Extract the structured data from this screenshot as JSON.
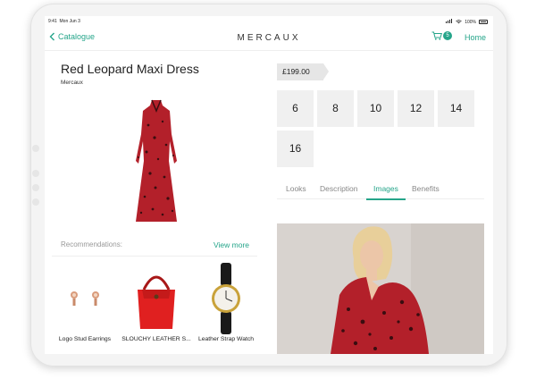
{
  "status": {
    "time": "9:41",
    "date": "Mon Jun 3",
    "battery": "100%"
  },
  "nav": {
    "back_label": "Catalogue",
    "brand": "MERCAUX",
    "cart_count": "5",
    "home_label": "Home"
  },
  "product": {
    "title": "Red Leopard Maxi Dress",
    "brand": "Mercaux",
    "price": "£199.00"
  },
  "sizes": [
    "6",
    "8",
    "10",
    "12",
    "14",
    "16"
  ],
  "tabs": [
    {
      "label": "Looks",
      "active": false
    },
    {
      "label": "Description",
      "active": false
    },
    {
      "label": "Images",
      "active": true
    },
    {
      "label": "Benefits",
      "active": false
    }
  ],
  "recommendations": {
    "label": "Recommendations:",
    "view_more": "View more",
    "items": [
      {
        "name": "Logo Stud Earrings"
      },
      {
        "name": "SLOUCHY LEATHER S..."
      },
      {
        "name": "Leather Strap Watch"
      }
    ]
  },
  "colors": {
    "accent": "#25a58a",
    "dress_red": "#b3202a"
  }
}
